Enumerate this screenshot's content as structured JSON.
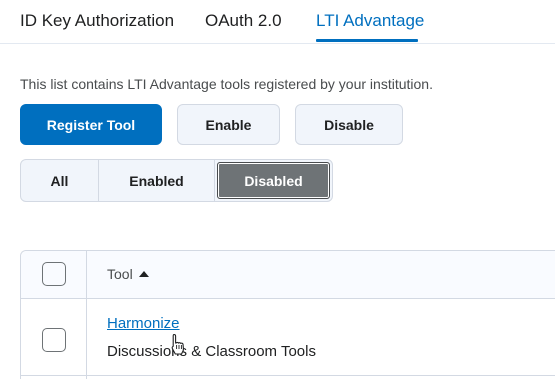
{
  "tabs": [
    {
      "label": "ID Key Authorization",
      "active": false
    },
    {
      "label": "OAuth 2.0",
      "active": false
    },
    {
      "label": "LTI Advantage",
      "active": true
    }
  ],
  "description": "This list contains LTI Advantage tools registered by your institution.",
  "actions": {
    "register_label": "Register Tool",
    "enable_label": "Enable",
    "disable_label": "Disable"
  },
  "filter": {
    "options": [
      "All",
      "Enabled",
      "Disabled"
    ],
    "selected": "Disabled"
  },
  "table": {
    "header_tool": "Tool",
    "sort_direction": "ascending",
    "rows": [
      {
        "name": "Harmonize",
        "category": "Discussions & Classroom Tools"
      }
    ]
  },
  "colors": {
    "accent": "#006fbf",
    "selected_segment": "#6e7376",
    "button_secondary_bg": "#f1f5fb"
  },
  "icons": {
    "sort": "sort-ascending-icon",
    "pointer": "hand-pointer-cursor-icon"
  }
}
